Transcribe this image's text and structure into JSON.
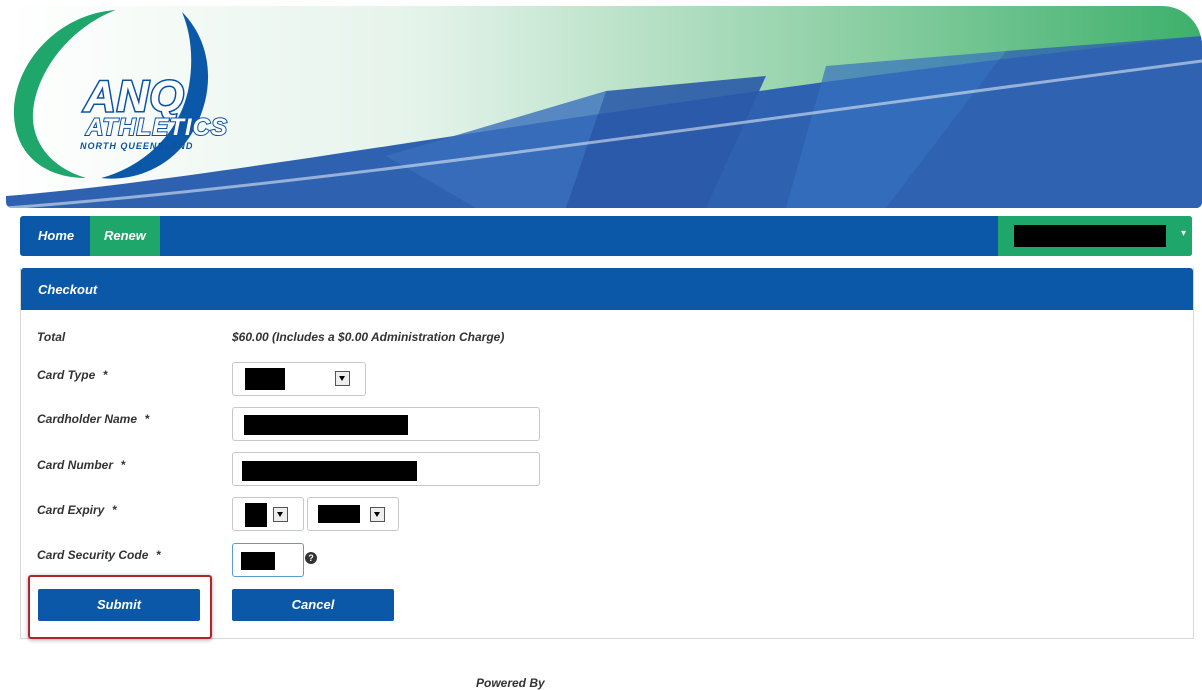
{
  "brand": {
    "logo_text": "ANQ",
    "logo_sub": "ATHLETICS",
    "logo_tag": "NORTH QUEENSLAND",
    "colors": {
      "primary": "#0b58a8",
      "accent": "#1fa66b",
      "highlight": "#b3232a"
    }
  },
  "nav": {
    "home": "Home",
    "renew": "Renew",
    "user_caret": "▾"
  },
  "checkout": {
    "title": "Checkout",
    "total_label": "Total",
    "total_value": "$60.00 (Includes a $0.00 Administration Charge)",
    "card_type_label": "Card Type",
    "cardholder_label": "Cardholder Name",
    "card_number_label": "Card Number",
    "card_expiry_label": "Card Expiry",
    "security_label": "Card Security Code",
    "required_mark": "*",
    "help_icon": "?",
    "submit": "Submit",
    "cancel": "Cancel"
  },
  "footer": {
    "powered_by": "Powered By"
  }
}
